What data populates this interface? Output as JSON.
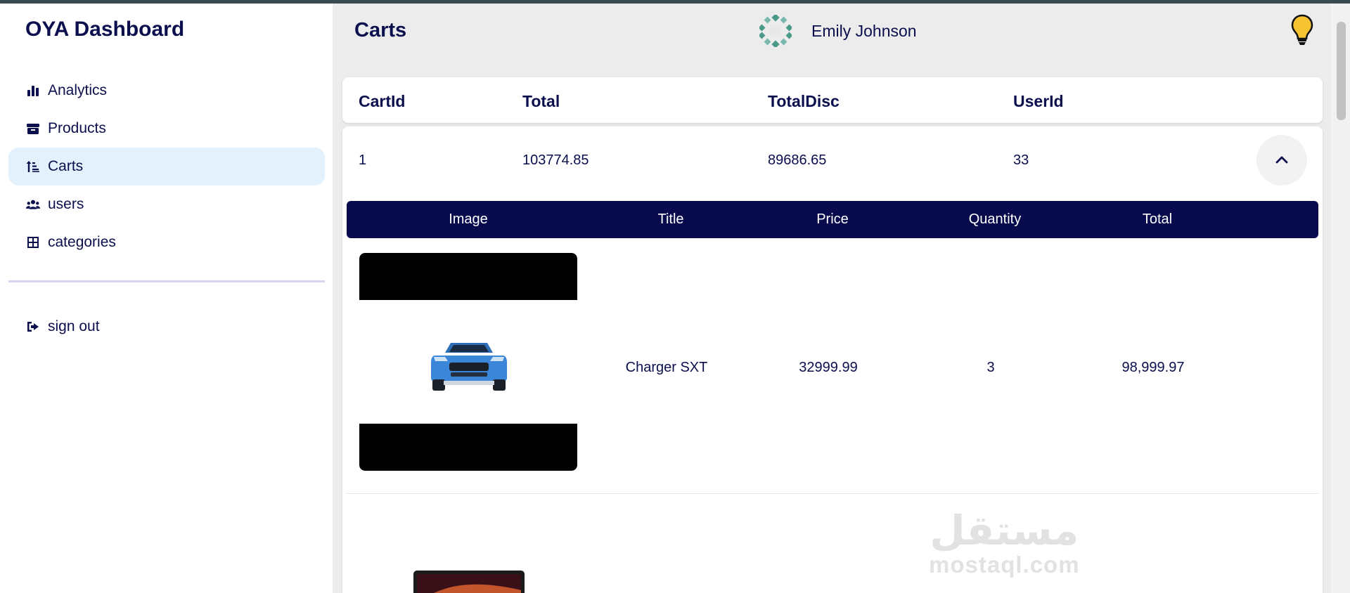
{
  "sidebar": {
    "brand": "OYA Dashboard",
    "items": [
      {
        "label": "Analytics",
        "icon": "bar-chart-icon"
      },
      {
        "label": "Products",
        "icon": "box-icon"
      },
      {
        "label": "Carts",
        "icon": "sort-icon",
        "active": true
      },
      {
        "label": "users",
        "icon": "users-icon"
      },
      {
        "label": "categories",
        "icon": "grid-icon"
      }
    ],
    "signout": {
      "label": "sign out",
      "icon": "sign-out-icon"
    }
  },
  "header": {
    "title": "Carts",
    "user_name": "Emily Johnson",
    "theme_icon": "lightbulb-icon"
  },
  "carts_table": {
    "columns": [
      "CartId",
      "Total",
      "TotalDisc",
      "UserId"
    ],
    "rows": [
      {
        "cart_id": "1",
        "total": "103774.85",
        "total_disc": "89686.65",
        "user_id": "33",
        "expanded": true
      }
    ]
  },
  "products_table": {
    "columns": [
      "Image",
      "Title",
      "Price",
      "Quantity",
      "Total"
    ],
    "rows": [
      {
        "title": "Charger SXT",
        "price": "32999.99",
        "quantity": "3",
        "total": "98,999.97",
        "image": "car-image"
      }
    ]
  },
  "watermark": {
    "arabic": "مستقل",
    "latin": "mostaql.com"
  },
  "colors": {
    "navy": "#0b0f4d",
    "table_header": "#070a4d",
    "active_nav": "#e3f1fc",
    "background": "#ececec",
    "divider": "#d8d4f0"
  }
}
